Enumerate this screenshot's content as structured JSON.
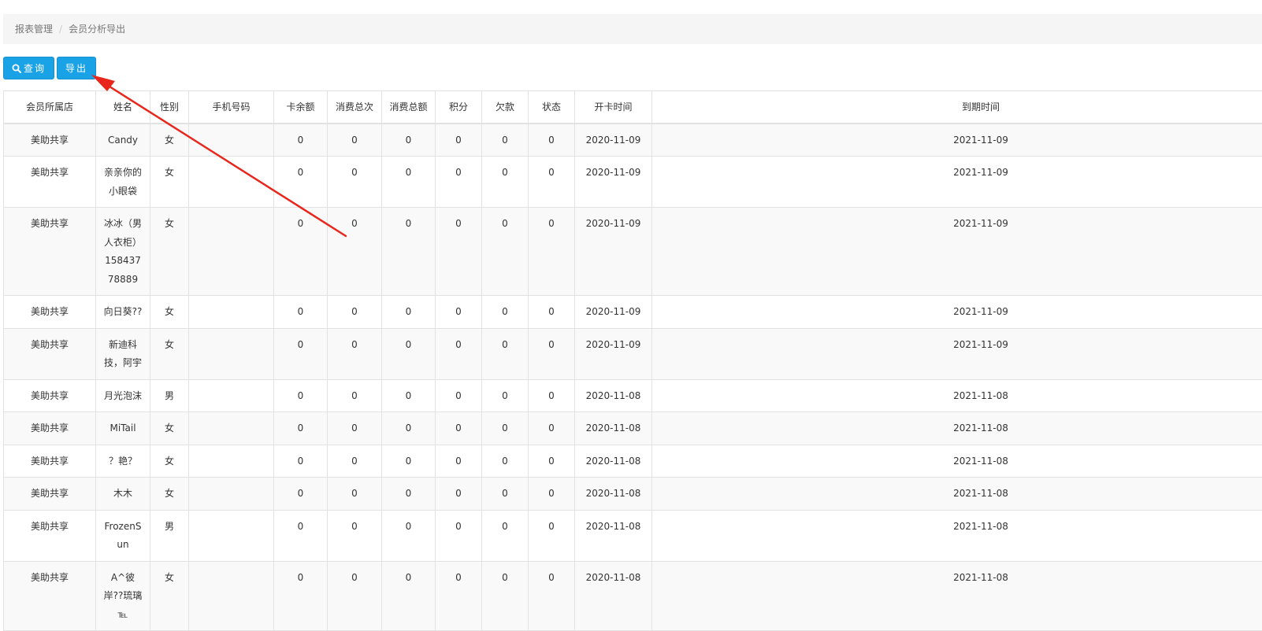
{
  "breadcrumb": {
    "parent": "报表管理",
    "separator": "/",
    "current": "会员分析导出"
  },
  "toolbar": {
    "query_label": "查询",
    "export_label": "导出"
  },
  "table": {
    "headers": [
      "会员所属店",
      "姓名",
      "性别",
      "手机号码",
      "卡余额",
      "消费总次",
      "消费总额",
      "积分",
      "欠款",
      "状态",
      "开卡时间",
      "到期时间"
    ],
    "rows": [
      {
        "store": "美助共享",
        "name": "Candy",
        "gender": "女",
        "phone": "",
        "balance": "0",
        "consume_count": "0",
        "consume_total": "0",
        "points": "0",
        "debt": "0",
        "status": "0",
        "open_date": "2020-11-09",
        "expire_date": "2021-11-09"
      },
      {
        "store": "美助共享",
        "name": "亲亲你的小眼袋",
        "gender": "女",
        "phone": "",
        "balance": "0",
        "consume_count": "0",
        "consume_total": "0",
        "points": "0",
        "debt": "0",
        "status": "0",
        "open_date": "2020-11-09",
        "expire_date": "2021-11-09"
      },
      {
        "store": "美助共享",
        "name": "冰冰（男人衣柜）15843778889",
        "gender": "女",
        "phone": "",
        "balance": "0",
        "consume_count": "0",
        "consume_total": "0",
        "points": "0",
        "debt": "0",
        "status": "0",
        "open_date": "2020-11-09",
        "expire_date": "2021-11-09"
      },
      {
        "store": "美助共享",
        "name": "向日葵??",
        "gender": "女",
        "phone": "",
        "balance": "0",
        "consume_count": "0",
        "consume_total": "0",
        "points": "0",
        "debt": "0",
        "status": "0",
        "open_date": "2020-11-09",
        "expire_date": "2021-11-09"
      },
      {
        "store": "美助共享",
        "name": "新迪科技，阿宇",
        "gender": "女",
        "phone": "",
        "balance": "0",
        "consume_count": "0",
        "consume_total": "0",
        "points": "0",
        "debt": "0",
        "status": "0",
        "open_date": "2020-11-09",
        "expire_date": "2021-11-09"
      },
      {
        "store": "美助共享",
        "name": "月光泡沫",
        "gender": "男",
        "phone": "",
        "balance": "0",
        "consume_count": "0",
        "consume_total": "0",
        "points": "0",
        "debt": "0",
        "status": "0",
        "open_date": "2020-11-08",
        "expire_date": "2021-11-08"
      },
      {
        "store": "美助共享",
        "name": "MiTail",
        "gender": "女",
        "phone": "",
        "balance": "0",
        "consume_count": "0",
        "consume_total": "0",
        "points": "0",
        "debt": "0",
        "status": "0",
        "open_date": "2020-11-08",
        "expire_date": "2021-11-08"
      },
      {
        "store": "美助共享",
        "name": "？艳？",
        "gender": "女",
        "phone": "",
        "balance": "0",
        "consume_count": "0",
        "consume_total": "0",
        "points": "0",
        "debt": "0",
        "status": "0",
        "open_date": "2020-11-08",
        "expire_date": "2021-11-08"
      },
      {
        "store": "美助共享",
        "name": "木木",
        "gender": "女",
        "phone": "",
        "balance": "0",
        "consume_count": "0",
        "consume_total": "0",
        "points": "0",
        "debt": "0",
        "status": "0",
        "open_date": "2020-11-08",
        "expire_date": "2021-11-08"
      },
      {
        "store": "美助共享",
        "name": "FrozenSun",
        "gender": "男",
        "phone": "",
        "balance": "0",
        "consume_count": "0",
        "consume_total": "0",
        "points": "0",
        "debt": "0",
        "status": "0",
        "open_date": "2020-11-08",
        "expire_date": "2021-11-08"
      },
      {
        "store": "美助共享",
        "name": "A^彼岸??琉璃℡",
        "gender": "女",
        "phone": "",
        "balance": "0",
        "consume_count": "0",
        "consume_total": "0",
        "points": "0",
        "debt": "0",
        "status": "0",
        "open_date": "2020-11-08",
        "expire_date": "2021-11-08"
      }
    ]
  },
  "annotation": {
    "arrow_color": "#e8261c"
  },
  "colors": {
    "button_bg": "#1aa2e6",
    "breadcrumb_bg": "#f5f5f5"
  },
  "icons": {
    "query": "search-icon"
  }
}
